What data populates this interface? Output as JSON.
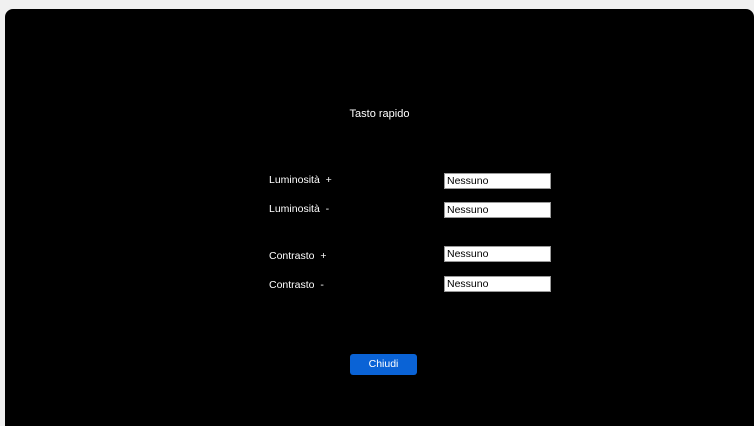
{
  "dialog": {
    "title": "Tasto rapido",
    "rows": [
      {
        "label": "Luminosità  +",
        "value": "Nessuno"
      },
      {
        "label": "Luminosità  -",
        "value": "Nessuno"
      },
      {
        "label": "Contrasto  +",
        "value": "Nessuno"
      },
      {
        "label": "Contrasto  -",
        "value": "Nessuno"
      }
    ],
    "close_label": "Chiudi"
  },
  "colors": {
    "background": "#000000",
    "accent": "#0a63d6"
  }
}
